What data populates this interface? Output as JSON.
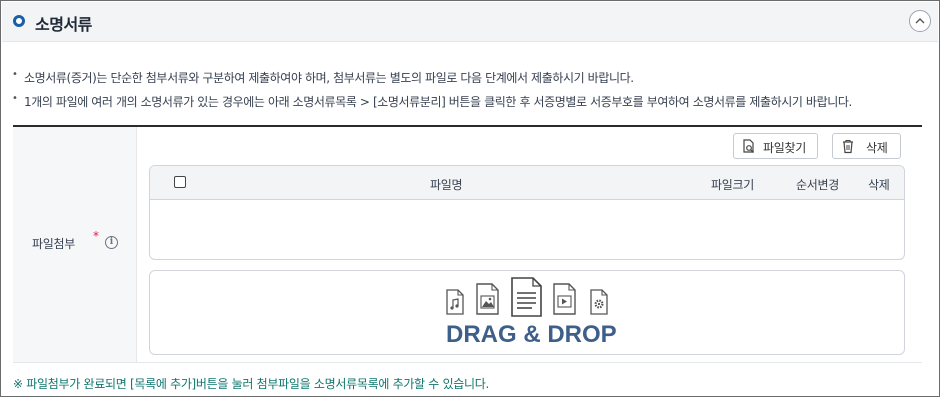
{
  "section": {
    "title": "소명서류"
  },
  "notes": [
    "소명서류(증거)는 단순한 첨부서류와 구분하여 제출하여야 하며, 첨부서류는 별도의 파일로 다음 단계에서 제출하시기 바랍니다.",
    "1개의 파일에 여러 개의 소명서류가 있는 경우에는 아래 소명서류목록 > [소명서류분리] 버튼을 클릭한 후 서증명별로 서증부호를 부여하여 소명서류를 제출하시기 바랍니다."
  ],
  "attach": {
    "label": "파일첨부",
    "required_mark": "*",
    "info_glyph": "i"
  },
  "toolbar": {
    "find_label": "파일찾기",
    "delete_label": "삭제"
  },
  "table": {
    "columns": {
      "name": "파일명",
      "size": "파일크기",
      "order": "순서변경",
      "delete": "삭제"
    }
  },
  "dropzone": {
    "text": "DRAG & DROP",
    "icons": [
      "audio-file-icon",
      "image-file-icon",
      "document-file-icon",
      "video-file-icon",
      "settings-file-icon"
    ]
  },
  "footnote": "※ 파일첨부가 완료되면 [목록에 추가]버튼을 눌러 첨부파일을 소명서류목록에 추가할 수 있습니다.",
  "colors": {
    "accent": "#1b5fa5",
    "dragdrop": "#3d5f89",
    "footnote": "#0f766e",
    "required": "#e11d48"
  }
}
